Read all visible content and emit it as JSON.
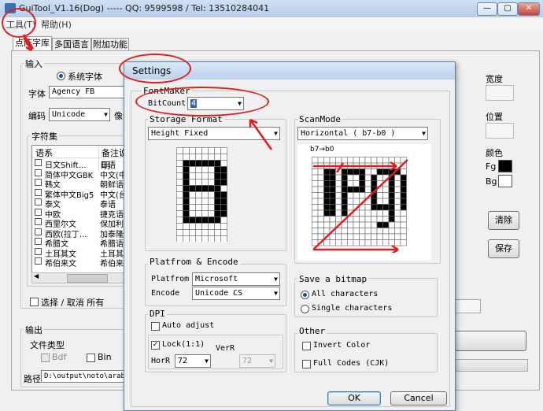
{
  "main": {
    "title": "GuiTool_V1.16(Dog) ----- QQ: 9599598 / Tel: 13510284041",
    "menu": [
      "工具(T)",
      "帮助(H)"
    ],
    "tabs": [
      "点阵字库",
      "多国语言",
      "附加功能"
    ],
    "input_group": "输入",
    "system_font": "系统字体",
    "font_label": "字体",
    "font_value": "Agency FB",
    "encode_label": "编码",
    "encode_value": "Unicode",
    "pixel_label": "像素",
    "charset_group": "字符集",
    "charset_headers": [
      "语系",
      "备注说明"
    ],
    "charset_rows": [
      [
        "日文Shift...",
        "日语"
      ],
      [
        "简体中文GBK",
        "中文(中"
      ],
      [
        "韩文",
        "朝鲜语"
      ],
      [
        "繁体中文Big5",
        "中文(台"
      ],
      [
        "泰文",
        "泰语"
      ],
      [
        "中欧",
        "捷克语"
      ],
      [
        "西里尔文",
        "保加利亚"
      ],
      [
        "西欧(拉丁...",
        "加泰隆语"
      ],
      [
        "希腊文",
        "希腊语"
      ],
      [
        "土耳其文",
        "土耳其语"
      ],
      [
        "希伯来文",
        "希伯来语"
      ]
    ],
    "select_all": "选择 / 取消 所有",
    "output_group": "输出",
    "file_type_label": "文件类型",
    "bdf_label": "Bdf",
    "bin_label": "Bin",
    "path_label": "路径",
    "path_value": "D:\\output\\noto\\arabic",
    "right_size_label": "宽度",
    "right_pos_label": "位置",
    "right_color_label": "颜色",
    "fg_label": "Fg",
    "bg_label": "Bg",
    "clear_button": "清除",
    "save_button": "保存"
  },
  "dialog": {
    "title": "Settings",
    "font_make_group": "FontMaker",
    "bitcount_label": "BitCount",
    "bitcount_value": "4",
    "storage_group": "Storage Format",
    "storage_value": "Height Fixed",
    "scanmode_group": "ScanMode",
    "scanmode_value": "Horizontal ( b7-b0 )",
    "scan_diagram_label": "b7→b0",
    "platform_group": "Platfrom & Encode",
    "platform_label": "Platfrom",
    "platform_value": "Microsoft",
    "encode_label": "Encode",
    "encode_value": "Unicode CS",
    "save_bitmap_group": "Save a bitmap",
    "all_characters": "All characters",
    "single_characters": "Single characters",
    "dpi_group": "DPI",
    "auto_adjust": "Auto adjust",
    "lock_label": "Lock(1:1)",
    "horr_label": "HorR",
    "horr_value": "72",
    "verr_label": "VerR",
    "verr_value": "72",
    "other_group": "Other",
    "invert_color": "Invert Color",
    "full_codes": "Full Codes (CJK)",
    "ok_button": "OK",
    "cancel_button": "Cancel"
  },
  "colors": {
    "annotation": "#e01e1e",
    "fg_swatch": "#000000",
    "bg_swatch": "#ffffff"
  }
}
